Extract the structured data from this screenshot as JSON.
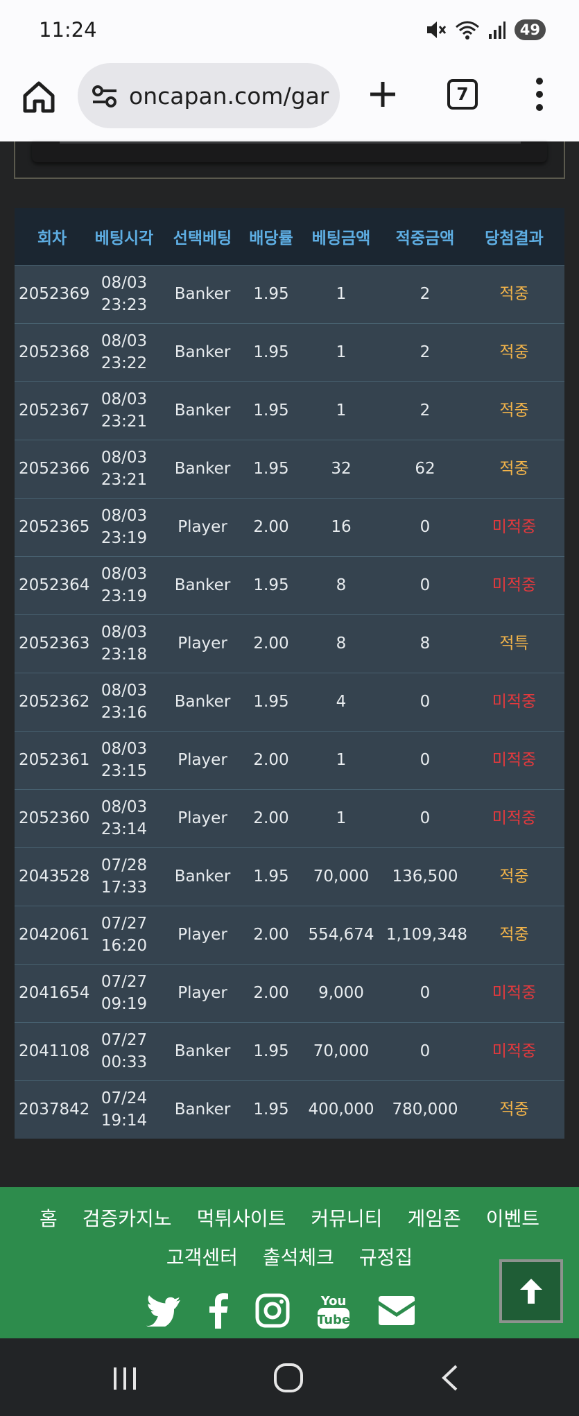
{
  "status": {
    "time": "11:24",
    "battery": "49"
  },
  "browser": {
    "url": "oncapan.com/gar",
    "tab_count": "7"
  },
  "table": {
    "headers": [
      "회차",
      "베팅시각",
      "선택베팅",
      "배당률",
      "베팅금액",
      "적중금액",
      "당첨결과"
    ],
    "rows": [
      {
        "round": "2052369",
        "date": "08/03",
        "time": "23:23",
        "pick": "Banker",
        "odds": "1.95",
        "bet": "1",
        "win": "2",
        "result": "적중",
        "status": "win"
      },
      {
        "round": "2052368",
        "date": "08/03",
        "time": "23:22",
        "pick": "Banker",
        "odds": "1.95",
        "bet": "1",
        "win": "2",
        "result": "적중",
        "status": "win"
      },
      {
        "round": "2052367",
        "date": "08/03",
        "time": "23:21",
        "pick": "Banker",
        "odds": "1.95",
        "bet": "1",
        "win": "2",
        "result": "적중",
        "status": "win"
      },
      {
        "round": "2052366",
        "date": "08/03",
        "time": "23:21",
        "pick": "Banker",
        "odds": "1.95",
        "bet": "32",
        "win": "62",
        "result": "적중",
        "status": "win"
      },
      {
        "round": "2052365",
        "date": "08/03",
        "time": "23:19",
        "pick": "Player",
        "odds": "2.00",
        "bet": "16",
        "win": "0",
        "result": "미적중",
        "status": "lose"
      },
      {
        "round": "2052364",
        "date": "08/03",
        "time": "23:19",
        "pick": "Banker",
        "odds": "1.95",
        "bet": "8",
        "win": "0",
        "result": "미적중",
        "status": "lose"
      },
      {
        "round": "2052363",
        "date": "08/03",
        "time": "23:18",
        "pick": "Player",
        "odds": "2.00",
        "bet": "8",
        "win": "8",
        "result": "적특",
        "status": "tie"
      },
      {
        "round": "2052362",
        "date": "08/03",
        "time": "23:16",
        "pick": "Banker",
        "odds": "1.95",
        "bet": "4",
        "win": "0",
        "result": "미적중",
        "status": "lose"
      },
      {
        "round": "2052361",
        "date": "08/03",
        "time": "23:15",
        "pick": "Player",
        "odds": "2.00",
        "bet": "1",
        "win": "0",
        "result": "미적중",
        "status": "lose"
      },
      {
        "round": "2052360",
        "date": "08/03",
        "time": "23:14",
        "pick": "Player",
        "odds": "2.00",
        "bet": "1",
        "win": "0",
        "result": "미적중",
        "status": "lose"
      },
      {
        "round": "2043528",
        "date": "07/28",
        "time": "17:33",
        "pick": "Banker",
        "odds": "1.95",
        "bet": "70,000",
        "win": "136,500",
        "result": "적중",
        "status": "win"
      },
      {
        "round": "2042061",
        "date": "07/27",
        "time": "16:20",
        "pick": "Player",
        "odds": "2.00",
        "bet": "554,674",
        "win": "1,109,348",
        "result": "적중",
        "status": "win"
      },
      {
        "round": "2041654",
        "date": "07/27",
        "time": "09:19",
        "pick": "Player",
        "odds": "2.00",
        "bet": "9,000",
        "win": "0",
        "result": "미적중",
        "status": "lose"
      },
      {
        "round": "2041108",
        "date": "07/27",
        "time": "00:33",
        "pick": "Banker",
        "odds": "1.95",
        "bet": "70,000",
        "win": "0",
        "result": "미적중",
        "status": "lose"
      },
      {
        "round": "2037842",
        "date": "07/24",
        "time": "19:14",
        "pick": "Banker",
        "odds": "1.95",
        "bet": "400,000",
        "win": "780,000",
        "result": "적중",
        "status": "win"
      }
    ]
  },
  "footer": {
    "nav_row1": [
      "홈",
      "검증카지노",
      "먹튀사이트",
      "커뮤니티",
      "게임존",
      "이벤트"
    ],
    "nav_row2": [
      "고객센터",
      "출석체크",
      "규정집"
    ],
    "social_icons": [
      "twitter-icon",
      "facebook-icon",
      "instagram-icon",
      "youtube-icon",
      "mail-icon"
    ]
  },
  "colors": {
    "header_text": "#5eaee3",
    "win": "#f1b34a",
    "lose": "#e4393d",
    "footer_bg": "#2d8c4c"
  }
}
